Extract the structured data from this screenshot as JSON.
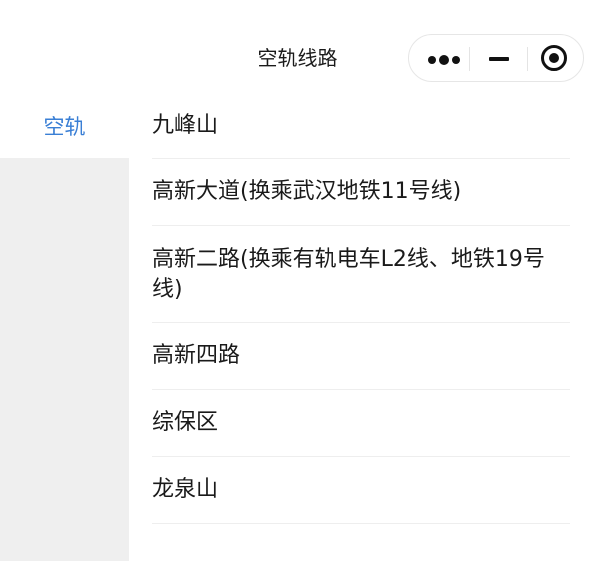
{
  "header": {
    "title": "空轨线路",
    "capsule": {
      "more_icon": "more-dots-icon",
      "minimize_icon": "minimize-icon",
      "close_icon": "target-close-icon"
    }
  },
  "sidebar": {
    "items": [
      {
        "label": "空轨",
        "active": true
      }
    ],
    "active_color": "#3a7fd5"
  },
  "stations": [
    {
      "name": "九峰山"
    },
    {
      "name": "高新大道(换乘武汉地铁11号线)"
    },
    {
      "name": "高新二路(换乘有轨电车L2线、地铁19号线)"
    },
    {
      "name": "高新四路"
    },
    {
      "name": "综保区"
    },
    {
      "name": "龙泉山"
    }
  ]
}
